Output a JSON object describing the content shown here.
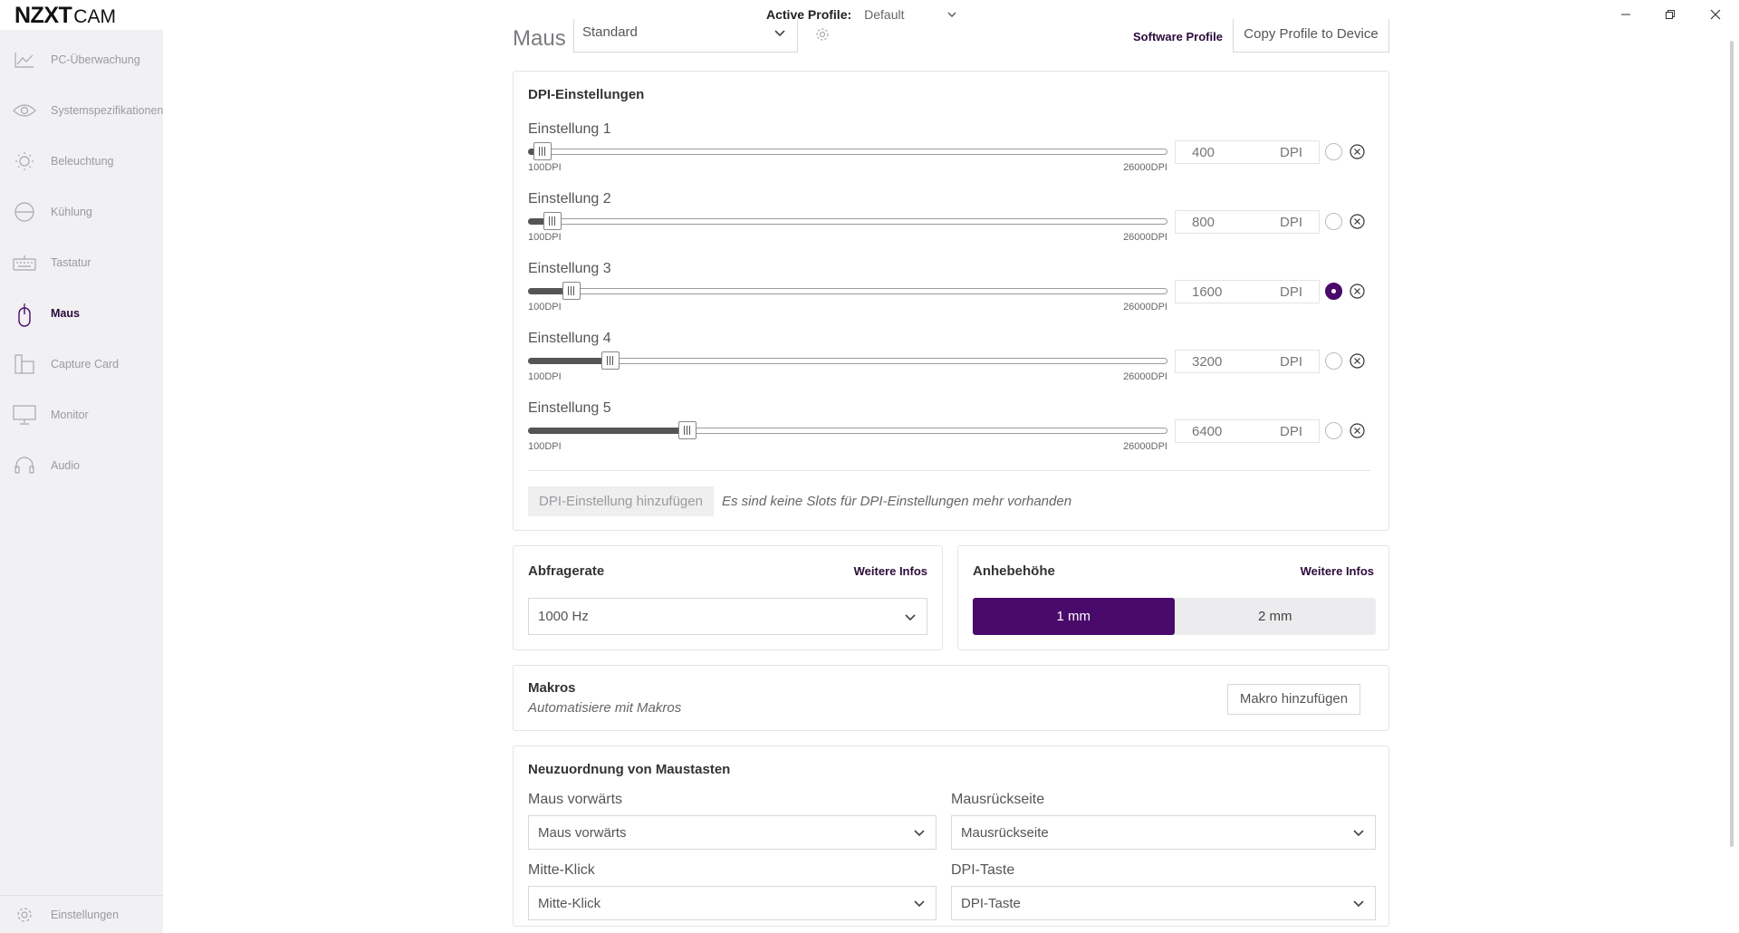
{
  "app": {
    "logo_bold": "NZXT",
    "logo_thin": "CAM",
    "profile_label": "Active Profile:",
    "profile_value": "Default"
  },
  "sidebar": {
    "items": [
      {
        "label": "PC-Überwachung",
        "icon": "chart-line-icon"
      },
      {
        "label": "Systemspezifikationen",
        "icon": "eye-icon"
      },
      {
        "label": "Beleuchtung",
        "icon": "sun-icon"
      },
      {
        "label": "Kühlung",
        "icon": "cooler-icon"
      },
      {
        "label": "Tastatur",
        "icon": "keyboard-icon"
      },
      {
        "label": "Maus",
        "icon": "mouse-icon",
        "active": true
      },
      {
        "label": "Capture Card",
        "icon": "capture-card-icon"
      },
      {
        "label": "Monitor",
        "icon": "monitor-icon"
      },
      {
        "label": "Audio",
        "icon": "headset-icon"
      }
    ],
    "footer_label": "Einstellungen"
  },
  "device": {
    "title": "Maus",
    "mode": "Standard",
    "software_profile": "Software Profile",
    "copy_profile": "Copy Profile to Device"
  },
  "dpi": {
    "title": "DPI-Einstellungen",
    "min_label": "100DPI",
    "max_label": "26000DPI",
    "min": 100,
    "max": 26000,
    "unit": "DPI",
    "stages": [
      {
        "name": "Einstellung 1",
        "value": "400",
        "selected": false
      },
      {
        "name": "Einstellung 2",
        "value": "800",
        "selected": false
      },
      {
        "name": "Einstellung 3",
        "value": "1600",
        "selected": true
      },
      {
        "name": "Einstellung 4",
        "value": "3200",
        "selected": false
      },
      {
        "name": "Einstellung 5",
        "value": "6400",
        "selected": false
      }
    ],
    "add_button": "DPI-Einstellung hinzufügen",
    "no_slots": "Es sind keine Slots für DPI-Einstellungen mehr vorhanden"
  },
  "polling": {
    "title": "Abfragerate",
    "more": "Weitere Infos",
    "value": "1000 Hz"
  },
  "lift": {
    "title": "Anhebehöhe",
    "more": "Weitere Infos",
    "options": [
      "1 mm",
      "2 mm"
    ],
    "selected": "1 mm"
  },
  "macros": {
    "title": "Makros",
    "subtitle": "Automatisiere mit Makros",
    "add_button": "Makro hinzufügen"
  },
  "remap": {
    "title": "Neuzuordnung von Maustasten",
    "fields": [
      {
        "label": "Maus vorwärts",
        "value": "Maus vorwärts"
      },
      {
        "label": "Mausrückseite",
        "value": "Mausrückseite"
      },
      {
        "label": "Mitte-Klick",
        "value": "Mitte-Klick"
      },
      {
        "label": "DPI-Taste",
        "value": "DPI-Taste"
      }
    ]
  },
  "colors": {
    "accent": "#4a0a6b",
    "sidebar_bg": "#f1f1f3"
  }
}
